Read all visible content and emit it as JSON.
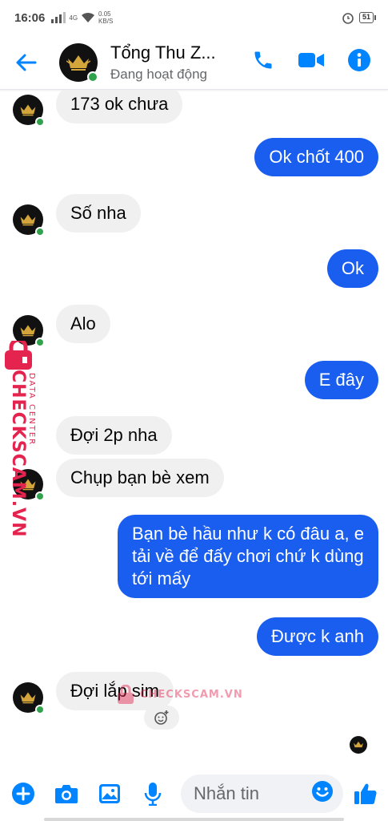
{
  "status_bar": {
    "time": "16:06",
    "network": "4G",
    "speed_value": "0.05",
    "speed_unit": "KB/S",
    "battery": "51"
  },
  "header": {
    "contact_name": "Tổng Thu Z...",
    "contact_status": "Đang hoạt động",
    "avatar_icon": "gold-crown-logo",
    "accent_color": "#0084ff"
  },
  "messages": [
    {
      "direction": "in",
      "text": "173 ok chưa",
      "avatar": true
    },
    {
      "direction": "out",
      "text": "Ok chốt 400"
    },
    {
      "direction": "in",
      "text": "Số nha",
      "avatar": true
    },
    {
      "direction": "out",
      "text": "Ok"
    },
    {
      "direction": "in",
      "text": "Alo",
      "avatar": true
    },
    {
      "direction": "out",
      "text": "E đây"
    },
    {
      "direction": "in",
      "text": "Đợi 2p nha",
      "avatar": false
    },
    {
      "direction": "in",
      "text": "Chụp bạn bè xem",
      "avatar": true
    },
    {
      "direction": "out",
      "text": "Bạn bè hầu như k có đâu a, e tải về để đấy chơi chứ k dùng tới mấy"
    },
    {
      "direction": "out",
      "text": "Được k anh"
    },
    {
      "direction": "in",
      "text": "Đợi lắp sim",
      "avatar": true
    }
  ],
  "watermark": {
    "vertical_main": "CHECKSCAM.VN",
    "vertical_sub": "DATA CENTER",
    "horizontal": "CHECKSCAM.VN"
  },
  "composer": {
    "placeholder": "Nhắn tin"
  },
  "colors": {
    "outgoing_bubble": "#1a5ef0",
    "incoming_bubble": "#f0f0f0",
    "online": "#31a24c",
    "watermark": "#e4234f"
  }
}
